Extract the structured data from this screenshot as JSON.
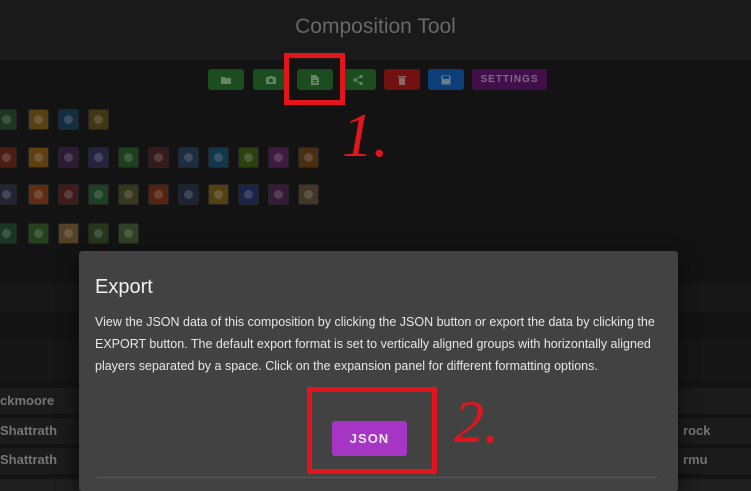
{
  "app": {
    "title": "Composition Tool"
  },
  "toolbar": {
    "buttons": [
      {
        "id": "open",
        "icon": "folder-open-icon",
        "color": "#2e7d32"
      },
      {
        "id": "screenshot",
        "icon": "camera-icon",
        "color": "#2e7d32"
      },
      {
        "id": "export",
        "icon": "file-document-icon",
        "color": "#2e7d32"
      },
      {
        "id": "share",
        "icon": "share-icon",
        "color": "#2e7d32"
      },
      {
        "id": "delete",
        "icon": "trash-icon",
        "color": "#b71c1c"
      },
      {
        "id": "save",
        "icon": "save-icon",
        "color": "#1565c0"
      },
      {
        "id": "settings",
        "label": "SETTINGS",
        "color": "#6a1b7a"
      }
    ]
  },
  "background_players": {
    "left": [
      "ckmoore",
      "Shattrath",
      "Shattrath"
    ],
    "right": [
      "rock",
      "rmu"
    ]
  },
  "dialog": {
    "title": "Export",
    "text": "View the JSON data of this composition by clicking the JSON button or export the data by clicking the EXPORT button. The default export format is set to vertically aligned groups with horizontally aligned players separated by a space. Click on the expansion panel for different formatting options.",
    "json_label": "JSON",
    "accent": "#a635c5"
  },
  "annotations": {
    "step1": "1.",
    "step2": "2.",
    "color": "#e3141c"
  }
}
